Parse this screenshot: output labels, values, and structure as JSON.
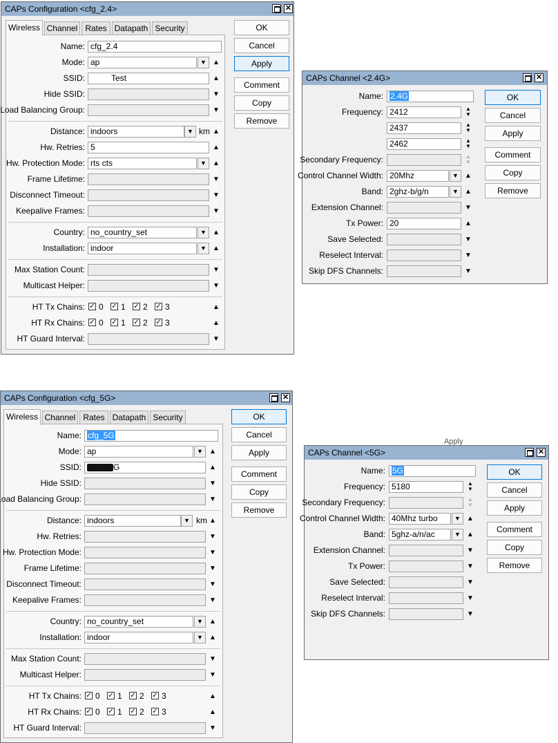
{
  "win1": {
    "title": "CAPs Configuration <cfg_2.4>",
    "tabs": [
      "Wireless",
      "Channel",
      "Rates",
      "Datapath",
      "Security"
    ],
    "buttons": [
      "OK",
      "Cancel",
      "Apply",
      "Comment",
      "Copy",
      "Remove"
    ],
    "labels": {
      "name": "Name:",
      "mode": "Mode:",
      "ssid": "SSID:",
      "hide_ssid": "Hide SSID:",
      "lbg": "Load Balancing Group:",
      "distance": "Distance:",
      "hw_retries": "Hw. Retries:",
      "hw_prot": "Hw. Protection Mode:",
      "frame_life": "Frame Lifetime:",
      "disc_timeout": "Disconnect Timeout:",
      "keepalive": "Keepalive Frames:",
      "country": "Country:",
      "installation": "Installation:",
      "max_sta": "Max Station Count:",
      "mcast": "Multicast Helper:",
      "ht_tx": "HT Tx Chains:",
      "ht_rx": "HT Rx Chains:",
      "ht_guard": "HT Guard Interval:"
    },
    "values": {
      "name": "cfg_2.4",
      "mode": "ap",
      "ssid": "Test",
      "distance": "indoors",
      "distance_unit": "km",
      "hw_retries": "5",
      "hw_prot": "rts cts",
      "country": "no_country_set",
      "installation": "indoor"
    },
    "chains": [
      "0",
      "1",
      "2",
      "3"
    ]
  },
  "win2": {
    "title": "CAPs Channel <2.4G>",
    "buttons": [
      "OK",
      "Cancel",
      "Apply",
      "Comment",
      "Copy",
      "Remove"
    ],
    "labels": {
      "name": "Name:",
      "frequency": "Frequency:",
      "sec_freq": "Secondary Frequency:",
      "ccw": "Control Channel Width:",
      "band": "Band:",
      "ext_chan": "Extension Channel:",
      "tx_power": "Tx Power:",
      "save_sel": "Save Selected:",
      "reselect": "Reselect Interval:",
      "skip_dfs": "Skip DFS Channels:"
    },
    "values": {
      "name": "2.4G",
      "freq1": "2412",
      "freq2": "2437",
      "freq3": "2462",
      "ccw": "20Mhz",
      "band": "2ghz-b/g/n",
      "tx_power": "20"
    }
  },
  "win3": {
    "title": "CAPs Configuration <cfg_5G>",
    "tabs": [
      "Wireless",
      "Channel",
      "Rates",
      "Datapath",
      "Security"
    ],
    "buttons": [
      "OK",
      "Cancel",
      "Apply",
      "Comment",
      "Copy",
      "Remove"
    ],
    "labels": {
      "name": "Name:",
      "mode": "Mode:",
      "ssid": "SSID:",
      "hide_ssid": "Hide SSID:",
      "lbg": "Load Balancing Group:",
      "distance": "Distance:",
      "hw_retries": "Hw. Retries:",
      "hw_prot": "Hw. Protection Mode:",
      "frame_life": "Frame Lifetime:",
      "disc_timeout": "Disconnect Timeout:",
      "keepalive": "Keepalive Frames:",
      "country": "Country:",
      "installation": "Installation:",
      "max_sta": "Max Station Count:",
      "mcast": "Multicast Helper:",
      "ht_tx": "HT Tx Chains:",
      "ht_rx": "HT Rx Chains:",
      "ht_guard": "HT Guard Interval:"
    },
    "values": {
      "name": "cfg_5G",
      "mode": "ap",
      "ssid_suffix": "G",
      "distance": "indoors",
      "distance_unit": "km",
      "country": "no_country_set",
      "installation": "indoor"
    },
    "chains": [
      "0",
      "1",
      "2",
      "3"
    ]
  },
  "win4": {
    "title": "CAPs Channel <5G>",
    "buttons": [
      "OK",
      "Cancel",
      "Apply",
      "Comment",
      "Copy",
      "Remove"
    ],
    "labels": {
      "name": "Name:",
      "frequency": "Frequency:",
      "sec_freq": "Secondary Frequency:",
      "ccw": "Control Channel Width:",
      "band": "Band:",
      "ext_chan": "Extension Channel:",
      "tx_power": "Tx Power:",
      "save_sel": "Save Selected:",
      "reselect": "Reselect Interval:",
      "skip_dfs": "Skip DFS Channels:"
    },
    "values": {
      "name": "5G",
      "freq": "5180",
      "ccw": "40Mhz turbo",
      "band": "5ghz-a/n/ac"
    }
  },
  "background": {
    "apply_ghost": "Apply"
  },
  "glyphs": {
    "up": "▲",
    "down": "▼",
    "updown": "▲▼",
    "dd": "▼",
    "check": "✓",
    "close": "✕"
  }
}
